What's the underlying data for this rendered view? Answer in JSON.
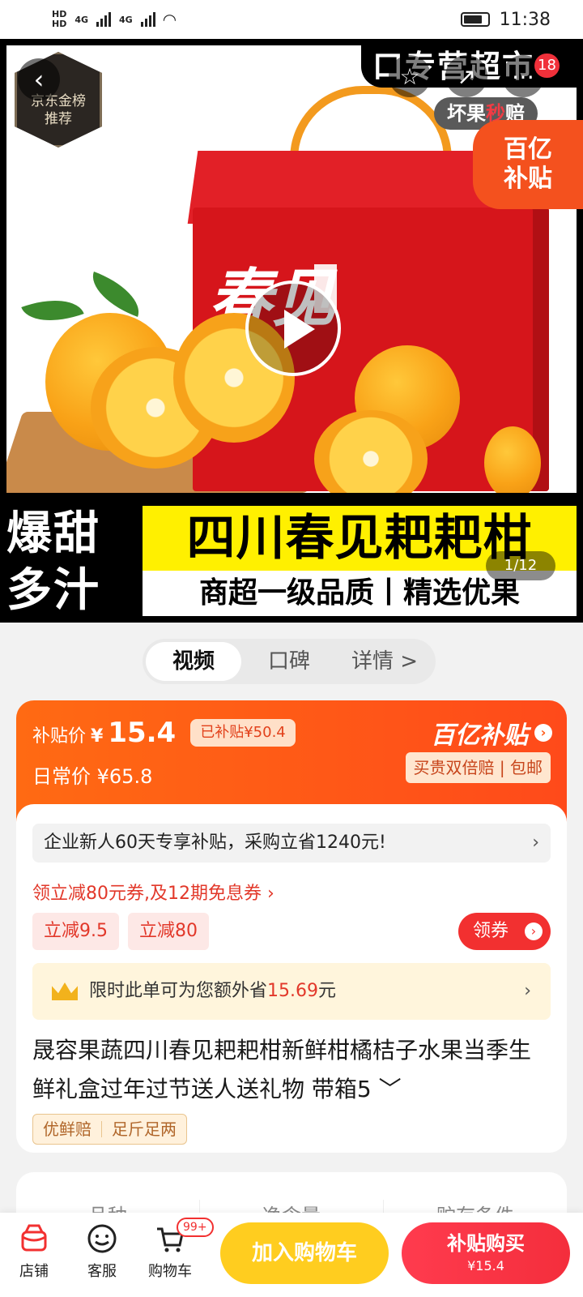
{
  "status_bar": {
    "sim1": "HD",
    "sim2": "HD",
    "net1": "4G",
    "net2": "4G",
    "time": "11:38"
  },
  "hero": {
    "rank_badge_line1": "京东金榜",
    "rank_badge_line2": "推荐",
    "top_banner": "口专营超市",
    "cart_count": "18",
    "slogan_a": "坏果",
    "slogan_b": "秒",
    "slogan_c": "赔",
    "subsidy_corner_line1": "百亿",
    "subsidy_corner_line2": "补贴",
    "box_script": "春见",
    "banner_left_line1": "爆甜",
    "banner_left_line2": "多汁",
    "banner_yellow": "四川春见耙耙柑",
    "banner_white": "商超一级品质丨精选优果",
    "page_indicator": "1/12"
  },
  "tabs": [
    {
      "label": "视频"
    },
    {
      "label": "口碑"
    },
    {
      "label": "详情 >"
    }
  ],
  "price": {
    "subsidy_label": "补贴价",
    "yen": "¥",
    "subsidy_price": "15.4",
    "subsidized_pill": "已补贴¥50.4",
    "regular_label": "日常价",
    "regular_price": "¥65.8",
    "brand": "百亿补贴",
    "brand_arrow": "›",
    "guarantee": "买贵双倍赔 | 包邮"
  },
  "info": {
    "promo_text": "企业新人60天专享补贴，采购立省1240元!",
    "promo_arrow": "›",
    "coupon_link": "领立减80元券,及12期免息券 ›",
    "tag1": "立减9.5",
    "tag2": "立减80",
    "coupon_button": "领券",
    "coupon_button_arrow": "›",
    "save_prefix": "限时此单可为您额外省",
    "save_amount": "15.69",
    "save_suffix": "元",
    "save_arrow": "›",
    "title": "晟容果蔬四川春见耙耙柑新鲜柑橘桔子水果当季生鲜礼盒过年过节送人送礼物 带箱5 ﹀",
    "quality_tag1": "优鲜赔",
    "quality_tag2": "足斤足两"
  },
  "specs": {
    "labels": [
      "品种",
      "净含量",
      "贮存条件"
    ]
  },
  "bottom_bar": {
    "shop": "店铺",
    "service": "客服",
    "cart": "购物车",
    "cart_badge": "99+",
    "add_to_cart": "加入购物车",
    "buy_label": "补贴购买",
    "buy_price": "¥15.4"
  },
  "colors": {
    "accent": "#ff5a17",
    "red": "#f23030",
    "yellow": "#ffcd1f"
  }
}
